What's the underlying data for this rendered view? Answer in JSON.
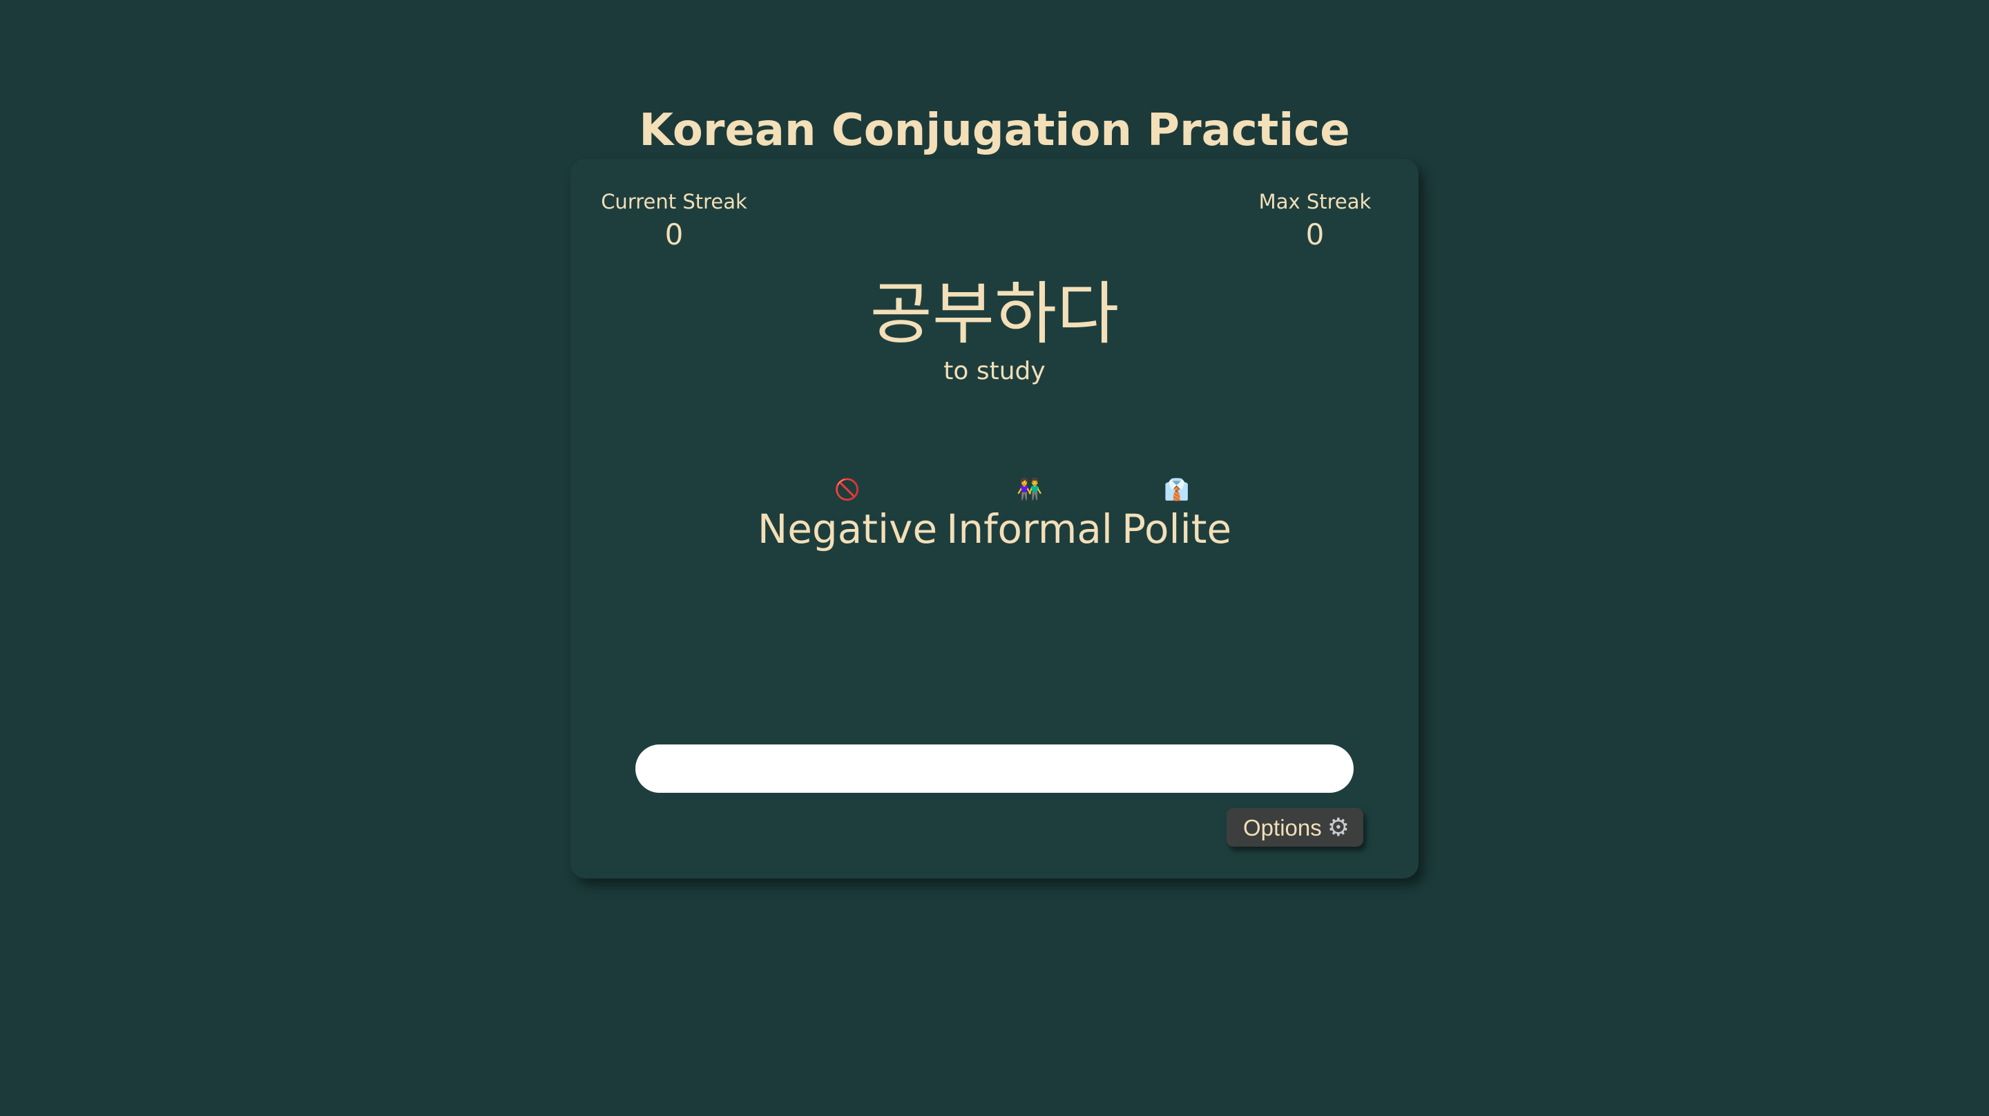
{
  "page": {
    "title": "Korean Conjugation Practice"
  },
  "streaks": {
    "current_label": "Current Streak",
    "current_value": "0",
    "max_label": "Max Streak",
    "max_value": "0"
  },
  "prompt": {
    "verb": "공부하다",
    "meaning": "to study"
  },
  "tags": [
    {
      "icon": "🚫",
      "icon_name": "prohibited-icon",
      "label": "Negative"
    },
    {
      "icon": "👫",
      "icon_name": "two-people-icon",
      "label": "Informal"
    },
    {
      "icon": "👔",
      "icon_name": "necktie-shirt-icon",
      "label": "Polite"
    }
  ],
  "answer": {
    "value": "",
    "placeholder": ""
  },
  "options": {
    "label": "Options",
    "icon": "⚙",
    "icon_name": "gear-icon"
  },
  "colors": {
    "background": "#1c3a3a",
    "card": "#1e3e3e",
    "text": "#f3dfb8",
    "button": "#3c3f3e"
  }
}
